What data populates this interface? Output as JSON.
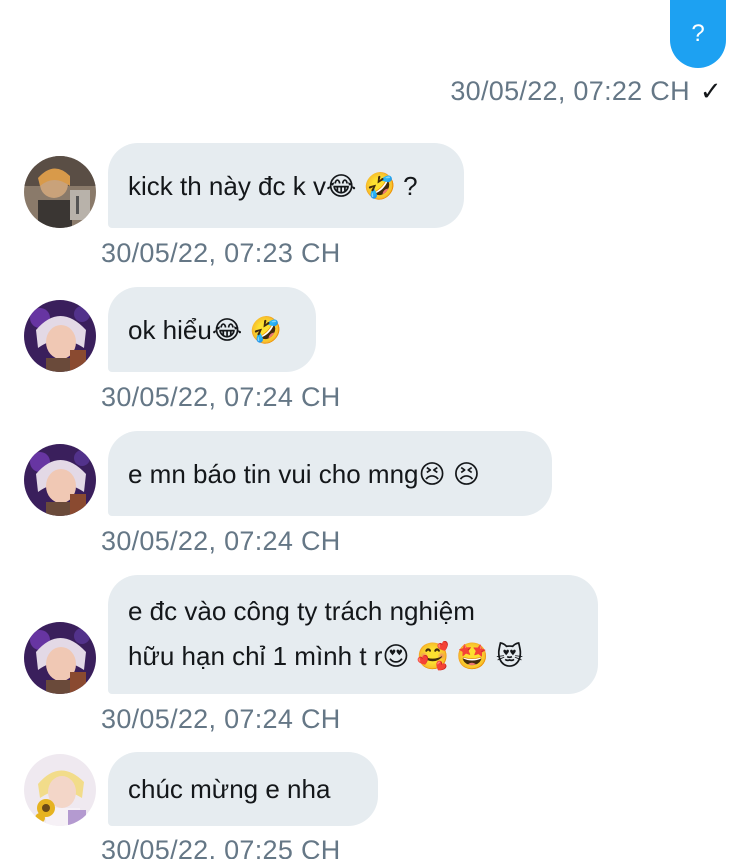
{
  "outgoing": {
    "text": "?",
    "time": "30/05/22, 07:22 CH",
    "check": "✓"
  },
  "messages": [
    {
      "text": "kick th này đc k v😂 🤣 ?",
      "time": "30/05/22, 07:23 CH",
      "avatar": "avatar-user-a"
    },
    {
      "text": "ok hiểu😂 🤣",
      "time": "30/05/22, 07:24 CH",
      "avatar": "avatar-user-b"
    },
    {
      "text": "e mn báo tin vui cho mng😣 😣",
      "time": "30/05/22, 07:24 CH",
      "avatar": "avatar-user-b"
    },
    {
      "line1": "e đc vào công ty trách nghiệm",
      "line2": "hữu hạn chỉ 1 mình t r😍 🥰 🤩 😻",
      "time": "30/05/22, 07:24 CH",
      "avatar": "avatar-user-b"
    },
    {
      "text": "chúc mừng e nha",
      "time": "30/05/22, 07:25 CH",
      "avatar": "avatar-user-c"
    }
  ],
  "colors": {
    "outgoing_bubble": "#1da1f2",
    "incoming_bubble": "#e6ecf0",
    "timestamp": "#657786"
  }
}
